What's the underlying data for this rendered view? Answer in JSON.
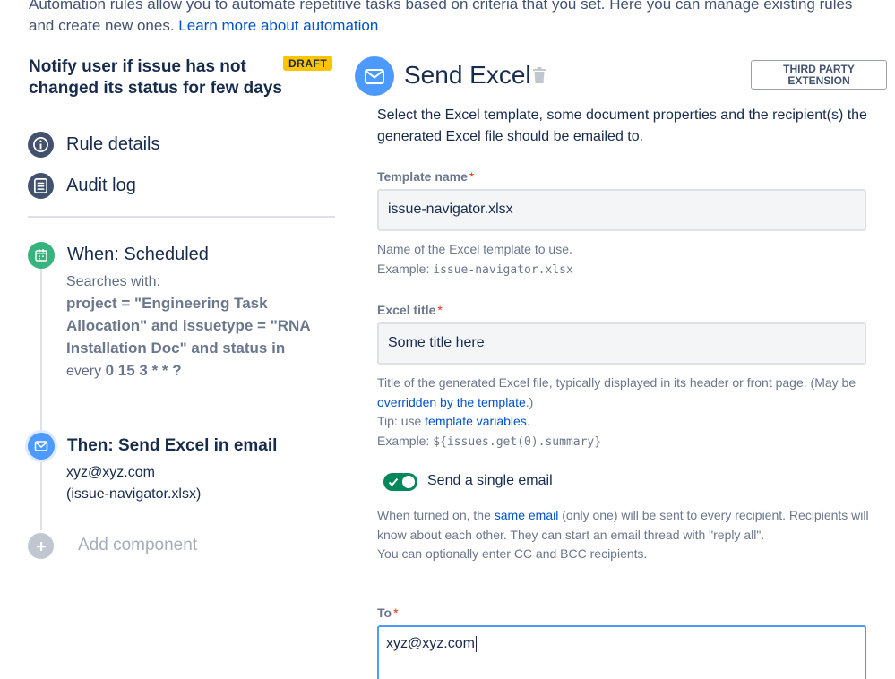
{
  "intro": {
    "text": "Automation rules allow you to automate repetitive tasks based on criteria that you set. Here you can manage existing rules and create new ones.",
    "link": "Learn more about automation"
  },
  "rule": {
    "title": "Notify user if issue has not changed its status for few days",
    "badge": "DRAFT"
  },
  "nav": [
    {
      "label": "Rule details",
      "icon": "info-icon"
    },
    {
      "label": "Audit log",
      "icon": "list-icon"
    }
  ],
  "when": {
    "icon": "calendar-icon",
    "title": "When: Scheduled",
    "searches_label": "Searches with:",
    "query": "project = \"Engineering Task Allocation\" and issuetype = \"RNA Installation Doc\" and status in",
    "every_label": "every",
    "cron": "0 15 3 * * ?"
  },
  "then": {
    "icon": "mail-icon",
    "title": "Then: Send Excel in email",
    "email": "xyz@xyz.com",
    "template": "(issue-navigator.xlsx)"
  },
  "add_component": {
    "icon": "plus-icon",
    "label": "Add component"
  },
  "component": {
    "icon": "mail-icon",
    "title": "Send Excel",
    "third_party": "THIRD PARTY EXTENSION",
    "description": "Select the Excel template, some document properties and the recipient(s) the generated Excel file should be emailed to."
  },
  "template_field": {
    "label": "Template name",
    "required": "*",
    "value": "issue-navigator.xlsx",
    "help": "Name of the Excel template to use.",
    "example_label": "Example:",
    "example": "issue-navigator.xlsx"
  },
  "title_field": {
    "label": "Excel title",
    "required": "*",
    "value": "Some title here",
    "help_1": "Title of the generated Excel file, typically displayed in its header or front page. (May be",
    "help_link": "overridden by the template",
    "help_2": ".)",
    "tip_label": "Tip: use",
    "tip_link": "template variables",
    "tip_end": ".",
    "example_label": "Example:",
    "example": "${issues.get(0).summary}"
  },
  "single_email": {
    "label": "Send a single email",
    "on": true,
    "help_1": "When turned on, the",
    "help_link": "same email",
    "help_2": "(only one) will be sent to every recipient. Recipients will know about each other. They can start an email thread with \"reply all\".",
    "help_3": "You can optionally enter CC and BCC recipients."
  },
  "to_field": {
    "label": "To",
    "required": "*",
    "value": "xyz@xyz.com"
  },
  "colors": {
    "link": "#0052cc",
    "draft": "#ffc400",
    "toggle_on": "#00875a",
    "when": "#36b37e",
    "action": "#4c9aff",
    "required": "#de350b"
  }
}
